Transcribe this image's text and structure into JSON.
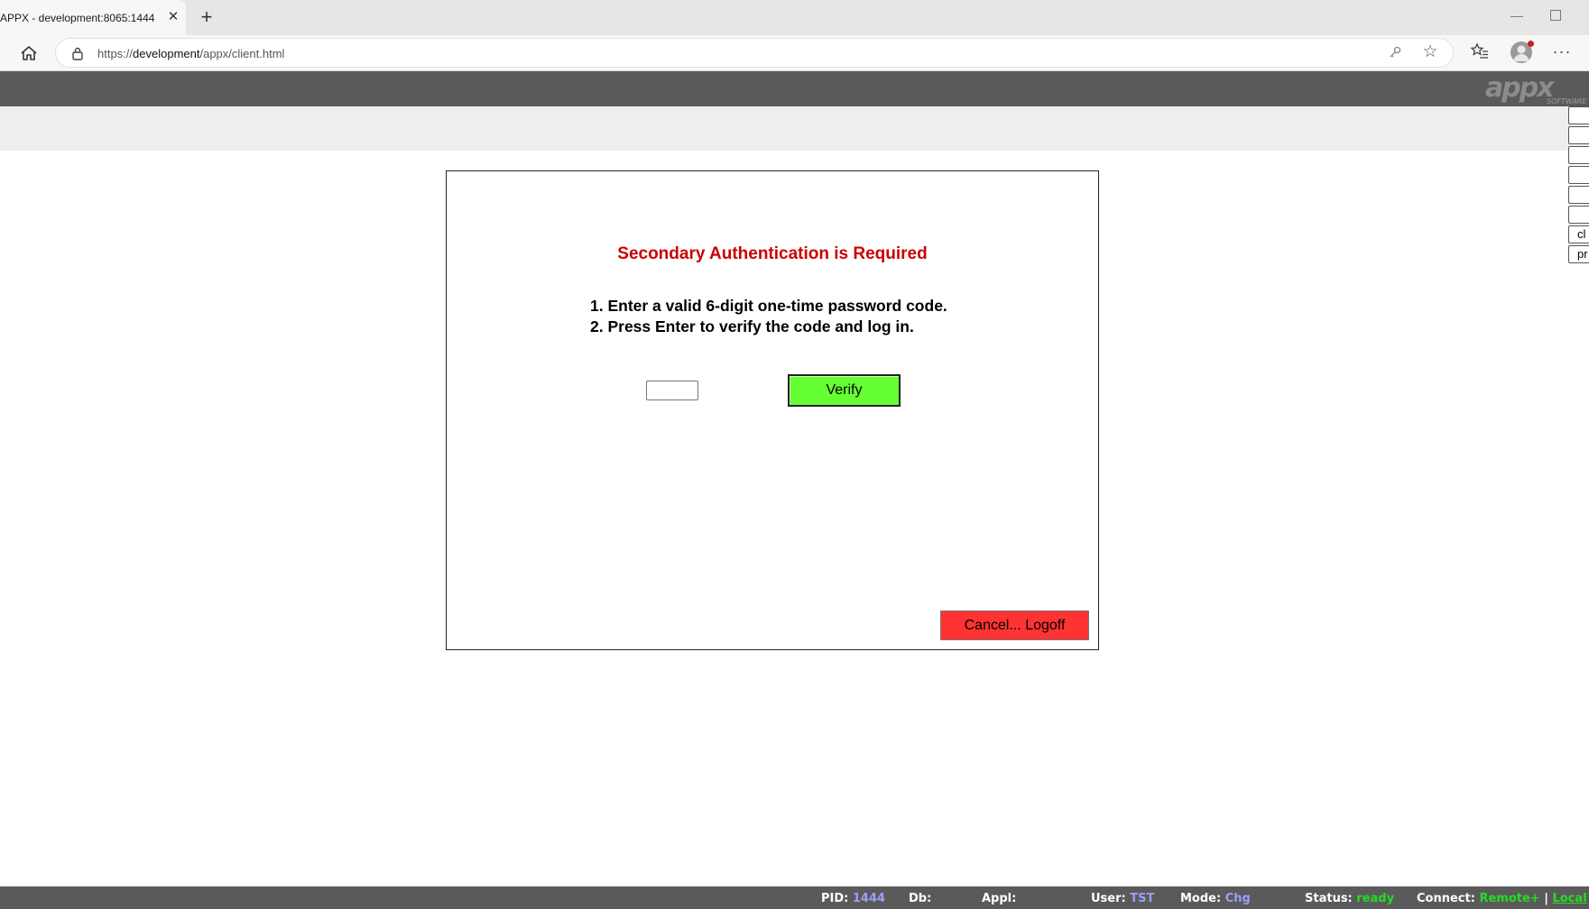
{
  "browser": {
    "tab_title": "APPX - development:8065:1444",
    "tab_close": "✕",
    "new_tab": "+",
    "url_prefix": "https://",
    "url_host": "development",
    "url_path": "/appx/client.html"
  },
  "side_buttons": [
    "",
    "",
    "",
    "",
    "",
    "",
    "cl",
    "pr"
  ],
  "dialog": {
    "title": "Secondary Authentication is Required",
    "instructions": [
      "1. Enter a valid 6-digit one-time password code.",
      "2. Press Enter to verify the code and log in."
    ],
    "otp_value": "",
    "verify_label": "Verify",
    "cancel_label": "Cancel... Logoff"
  },
  "statusbar": {
    "pid_label": "PID:",
    "pid_value": "1444",
    "db_label": "Db:",
    "db_value": "",
    "appl_label": "Appl:",
    "appl_value": "",
    "user_label": "User:",
    "user_value": "TST",
    "mode_label": "Mode:",
    "mode_value": "Chg",
    "status_label": "Status:",
    "status_value": "ready",
    "connect_label": "Connect:",
    "connect_value": "Remote+",
    "separator": "|",
    "local_link": "Local"
  },
  "colors": {
    "title_red": "#cc0000",
    "verify_green": "#66ff33",
    "cancel_red": "#ff3333",
    "status_blue": "#9d9dff",
    "status_green": "#22dd22",
    "header_gray": "#5a5a5a"
  },
  "icons": {
    "home": "home-icon",
    "lock": "lock-icon",
    "key": "key-icon",
    "star": "star-icon",
    "favorites": "favorites-icon",
    "profile": "profile-icon",
    "more": "more-icon",
    "logo": "appx-logo"
  }
}
